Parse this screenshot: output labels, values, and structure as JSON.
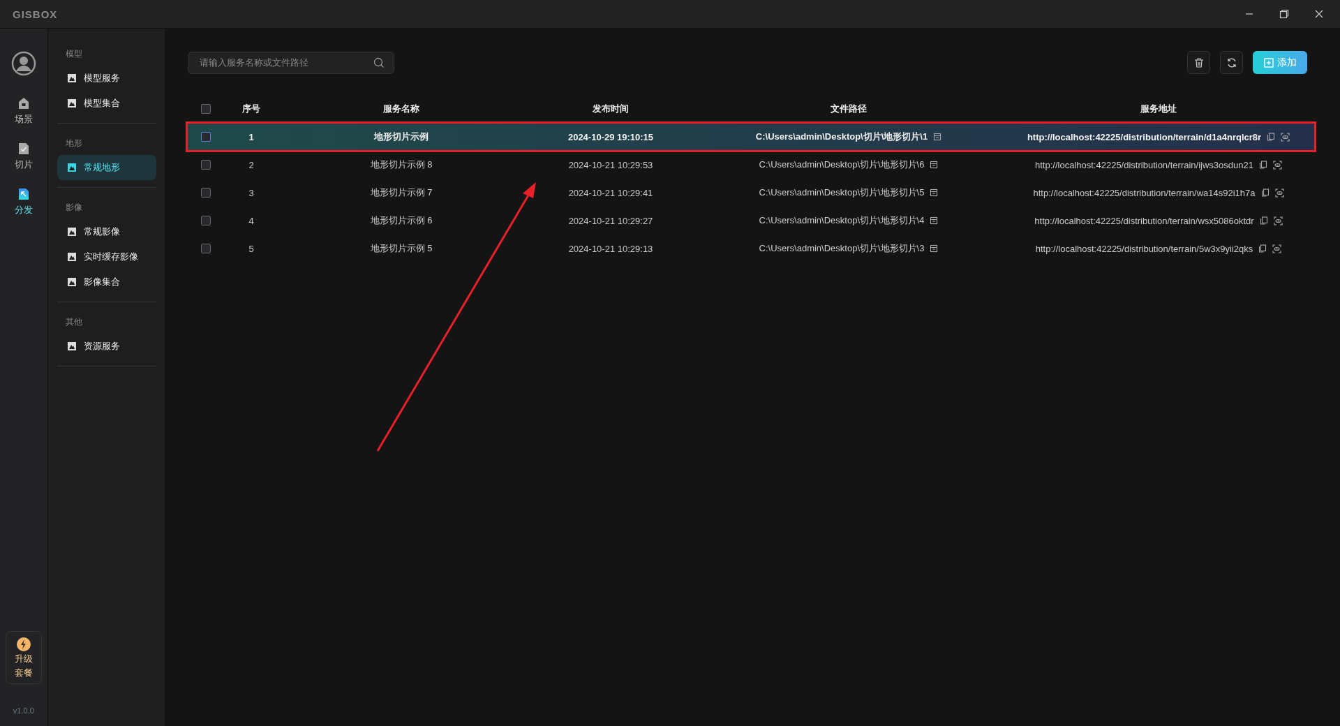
{
  "app": {
    "logo": "GISBOX"
  },
  "rail": {
    "items": [
      {
        "label": "场景",
        "kind": "home",
        "selected": false
      },
      {
        "label": "切片",
        "kind": "check",
        "selected": false
      },
      {
        "label": "分发",
        "kind": "share",
        "selected": true
      }
    ],
    "upgrade": [
      "升级",
      "套餐"
    ],
    "version": "v1.0.0"
  },
  "nav": {
    "groups": [
      {
        "title": "模型",
        "items": [
          {
            "label": "模型服务",
            "selected": false
          },
          {
            "label": "模型集合",
            "selected": false
          }
        ]
      },
      {
        "title": "地形",
        "items": [
          {
            "label": "常规地形",
            "selected": true
          }
        ]
      },
      {
        "title": "影像",
        "items": [
          {
            "label": "常规影像",
            "selected": false
          },
          {
            "label": "实时缓存影像",
            "selected": false
          },
          {
            "label": "影像集合",
            "selected": false
          }
        ]
      },
      {
        "title": "其他",
        "items": [
          {
            "label": "资源服务",
            "selected": false
          }
        ]
      }
    ]
  },
  "search": {
    "placeholder": "请输入服务名称或文件路径"
  },
  "toolbar": {
    "add_label": "添加"
  },
  "table": {
    "columns": [
      "序号",
      "服务名称",
      "发布时间",
      "文件路径",
      "服务地址"
    ],
    "header_checked": false,
    "rows": [
      {
        "selected": true,
        "checked": false,
        "index": "1",
        "name": "地形切片示例",
        "time": "2024-10-29 19:10:15",
        "path": "C:\\Users\\admin\\Desktop\\切片\\地形切片\\1",
        "url": "http://localhost:42225/distribution/terrain/d1a4nrqlcr8r"
      },
      {
        "selected": false,
        "checked": false,
        "index": "2",
        "name": "地形切片示例 8",
        "time": "2024-10-21 10:29:53",
        "path": "C:\\Users\\admin\\Desktop\\切片\\地形切片\\6",
        "url": "http://localhost:42225/distribution/terrain/ijws3osdun21"
      },
      {
        "selected": false,
        "checked": false,
        "index": "3",
        "name": "地形切片示例 7",
        "time": "2024-10-21 10:29:41",
        "path": "C:\\Users\\admin\\Desktop\\切片\\地形切片\\5",
        "url": "http://localhost:42225/distribution/terrain/wa14s92i1h7a"
      },
      {
        "selected": false,
        "checked": false,
        "index": "4",
        "name": "地形切片示例 6",
        "time": "2024-10-21 10:29:27",
        "path": "C:\\Users\\admin\\Desktop\\切片\\地形切片\\4",
        "url": "http://localhost:42225/distribution/terrain/wsx5086oktdr"
      },
      {
        "selected": false,
        "checked": false,
        "index": "5",
        "name": "地形切片示例 5",
        "time": "2024-10-21 10:29:13",
        "path": "C:\\Users\\admin\\Desktop\\切片\\地形切片\\3",
        "url": "http://localhost:42225/distribution/terrain/5w3x9yii2qks"
      }
    ]
  }
}
